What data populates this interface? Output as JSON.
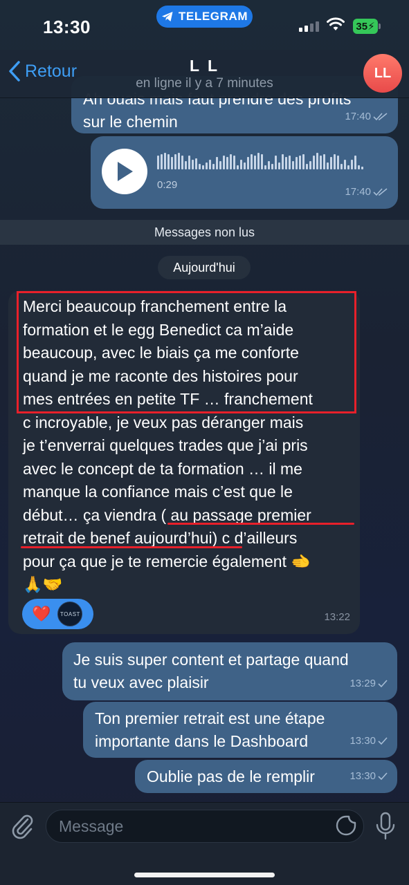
{
  "status_bar": {
    "time": "13:30",
    "app_pill": "TELEGRAM",
    "battery": "35"
  },
  "header": {
    "back_label": "Retour",
    "contact_name": "L L",
    "contact_status": "en ligne il y a 7 minutes",
    "avatar_initials": "LL"
  },
  "messages": {
    "m1": {
      "line1": "Ah ouais mais faut prendre des profits",
      "line2": "sur le chemin",
      "time": "17:40"
    },
    "voice": {
      "duration": "0:29",
      "time": "17:40"
    },
    "unread_label": "Messages non lus",
    "date_label": "Aujourd'hui",
    "incoming": {
      "lines": [
        "Merci beaucoup franchement entre la",
        "formation et le egg Benedict ca m’aide",
        "beaucoup, avec le biais ça me conforte",
        "quand je me raconte des histoires pour",
        "mes entrées en petite TF … franchement",
        "c incroyable, je veux pas déranger mais",
        "je t’enverrai quelques trades que j’ai pris",
        "avec le concept de ta formation … il me",
        "manque la confiance mais c’est que le",
        "début… ça viendra ( au passage premier",
        "retrait de benef aujourd’hui) c d’ailleurs",
        "pour ça que je te remercie également 🫲",
        "🙏🤝"
      ],
      "time": "13:22",
      "reaction_emoji": "❤️",
      "reaction_avatar_text": "TOAST"
    },
    "out1": {
      "line1": "Je suis super content et partage quand",
      "line2": "tu veux avec plaisir",
      "time": "13:29"
    },
    "out2": {
      "line1": "Ton premier retrait est une étape",
      "line2": "importante dans le Dashboard",
      "time": "13:30"
    },
    "out3": {
      "text": "Oublie pas de le remplir",
      "time": "13:30"
    }
  },
  "composer": {
    "placeholder": "Message"
  },
  "colors": {
    "accent": "#3e9ef5",
    "outgoing_bubble": "#3f6287",
    "incoming_bubble": "#222b38",
    "annotation_red": "#e8202a"
  }
}
